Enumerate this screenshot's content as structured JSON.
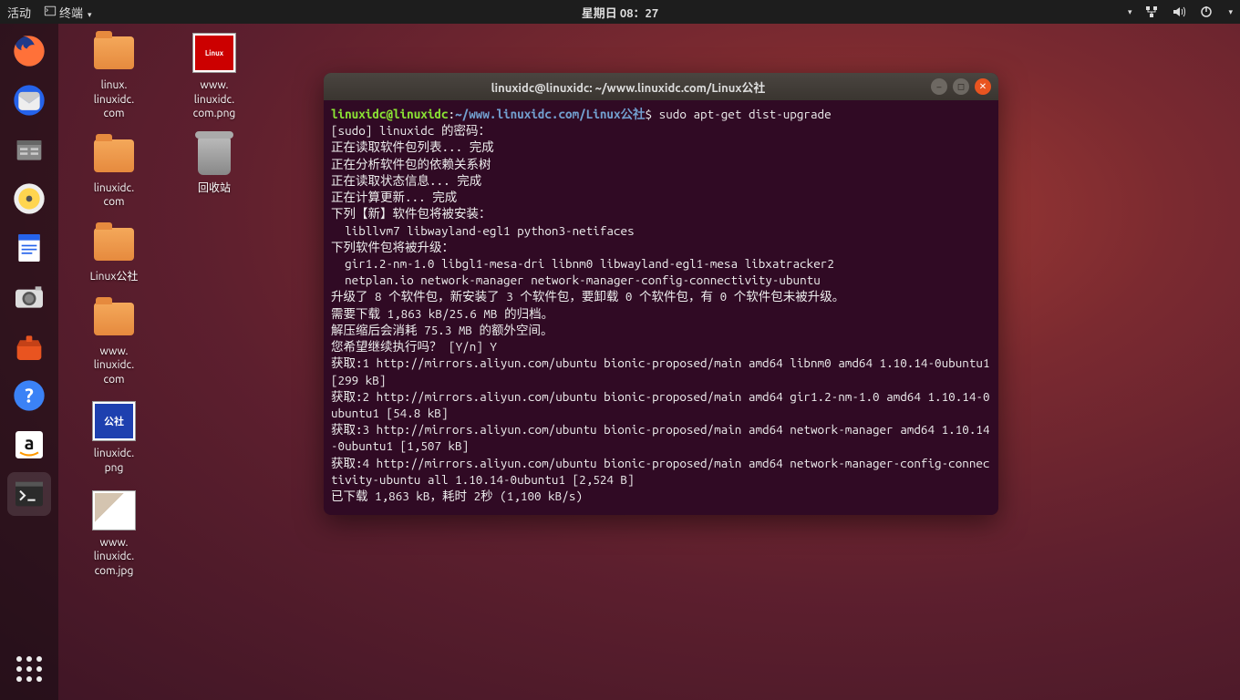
{
  "topbar": {
    "activities": "活动",
    "app_menu": "终端",
    "clock": "星期日 08：27"
  },
  "dock": {
    "items": [
      {
        "name": "firefox"
      },
      {
        "name": "thunderbird"
      },
      {
        "name": "files"
      },
      {
        "name": "rhythmbox"
      },
      {
        "name": "writer"
      },
      {
        "name": "camera"
      },
      {
        "name": "software"
      },
      {
        "name": "help"
      },
      {
        "name": "amazon"
      },
      {
        "name": "terminal"
      }
    ]
  },
  "desktop": {
    "col1": [
      {
        "type": "folder",
        "label": "linux.\nlinuxidc.\ncom"
      },
      {
        "type": "folder",
        "label": "linuxidc.\ncom"
      },
      {
        "type": "folder",
        "label": "Linux公社"
      },
      {
        "type": "folder",
        "label": "www.\nlinuxidc.\ncom"
      },
      {
        "type": "image-gs",
        "label": "linuxidc.\npng"
      },
      {
        "type": "image-photo",
        "label": "www.\nlinuxidc.\ncom.jpg"
      }
    ],
    "col2": [
      {
        "type": "image-linux",
        "label": "www.\nlinuxidc.\ncom.png"
      },
      {
        "type": "trash",
        "label": "回收站"
      }
    ]
  },
  "terminal": {
    "title": "linuxidc@linuxidc: ~/www.linuxidc.com/Linux公社",
    "prompt": {
      "user": "linuxidc",
      "host": "linuxidc",
      "path": "~/www.linuxidc.com/Linux公社",
      "command": "sudo apt-get dist-upgrade"
    },
    "lines": [
      "[sudo] linuxidc 的密码：",
      "正在读取软件包列表... 完成",
      "正在分析软件包的依赖关系树",
      "正在读取状态信息... 完成",
      "正在计算更新... 完成",
      "下列【新】软件包将被安装：",
      "  libllvm7 libwayland-egl1 python3-netifaces",
      "下列软件包将被升级：",
      "  gir1.2-nm-1.0 libgl1-mesa-dri libnm0 libwayland-egl1-mesa libxatracker2",
      "  netplan.io network-manager network-manager-config-connectivity-ubuntu",
      "升级了 8 个软件包，新安装了 3 个软件包，要卸载 0 个软件包，有 0 个软件包未被升级。",
      "需要下载 1,863 kB/25.6 MB 的归档。",
      "解压缩后会消耗 75.3 MB 的额外空间。",
      "您希望继续执行吗？ [Y/n] Y",
      "获取:1 http://mirrors.aliyun.com/ubuntu bionic-proposed/main amd64 libnm0 amd64 1.10.14-0ubuntu1 [299 kB]",
      "获取:2 http://mirrors.aliyun.com/ubuntu bionic-proposed/main amd64 gir1.2-nm-1.0 amd64 1.10.14-0ubuntu1 [54.8 kB]",
      "获取:3 http://mirrors.aliyun.com/ubuntu bionic-proposed/main amd64 network-manager amd64 1.10.14-0ubuntu1 [1,507 kB]",
      "获取:4 http://mirrors.aliyun.com/ubuntu bionic-proposed/main amd64 network-manager-config-connectivity-ubuntu all 1.10.14-0ubuntu1 [2,524 B]",
      "已下载 1,863 kB，耗时 2秒 (1,100 kB/s)"
    ]
  }
}
